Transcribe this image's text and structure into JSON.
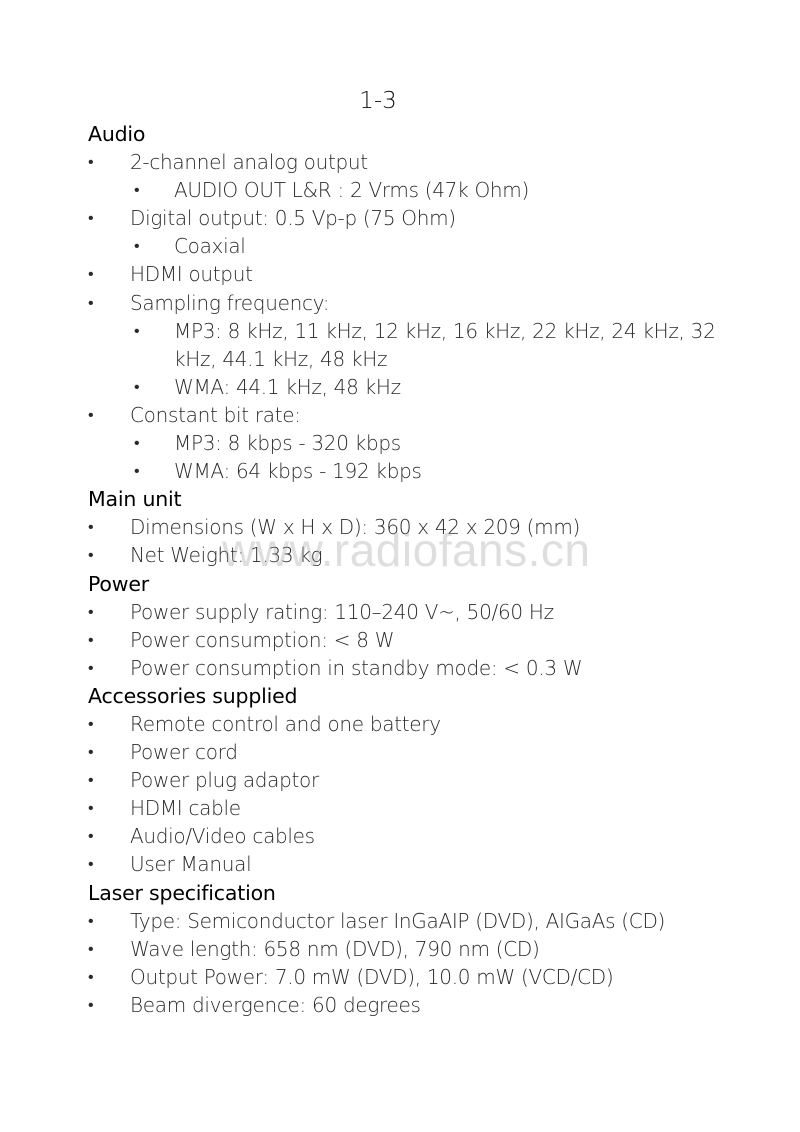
{
  "page_number": "1-3",
  "bullet_glyph": "•",
  "watermark": "www.radiofans.cn",
  "sections": {
    "audio": {
      "title": "Audio",
      "items": [
        {
          "text": "2-channel analog output"
        },
        {
          "text": "AUDIO OUT L&R : 2 Vrms (47k Ohm)",
          "level": 2
        },
        {
          "text": "Digital output: 0.5 Vp-p (75 Ohm)"
        },
        {
          "text": "Coaxial",
          "level": 2
        },
        {
          "text": "HDMI output"
        },
        {
          "text": "Sampling frequency:"
        },
        {
          "text": "MP3: 8 kHz, 11 kHz, 12 kHz, 16 kHz, 22 kHz, 24 kHz, 32",
          "level": 2
        },
        {
          "text": "kHz, 44.1 kHz, 48 kHz",
          "level": 2,
          "continuation": true
        },
        {
          "text": "WMA: 44.1 kHz, 48 kHz",
          "level": 2
        },
        {
          "text": "Constant bit rate:"
        },
        {
          "text": "MP3: 8 kbps - 320 kbps",
          "level": 2
        },
        {
          "text": "WMA: 64 kbps - 192 kbps",
          "level": 2
        }
      ]
    },
    "main_unit": {
      "title": "Main unit",
      "items": [
        {
          "text": "Dimensions (W x H x D): 360 x 42 x 209 (mm)"
        },
        {
          "text": "Net Weight: 1.33 kg"
        }
      ]
    },
    "power": {
      "title": "Power",
      "items": [
        {
          "text": "Power supply rating: 110–240 V~, 50/60 Hz"
        },
        {
          "text": "Power consumption: < 8 W"
        },
        {
          "text": "Power consumption in standby mode: < 0.3 W"
        }
      ]
    },
    "accessories": {
      "title": "Accessories supplied",
      "items": [
        {
          "text": "Remote control and one battery"
        },
        {
          "text": "Power cord"
        },
        {
          "text": "Power plug adaptor"
        },
        {
          "text": "HDMI cable"
        },
        {
          "text": "Audio/Video cables"
        },
        {
          "text": "User Manual"
        }
      ]
    },
    "laser": {
      "title": "Laser specification",
      "items": [
        {
          "text": "Type: Semiconductor laser InGaAIP (DVD), AIGaAs (CD)"
        },
        {
          "text": "Wave length: 658 nm (DVD), 790 nm (CD)"
        },
        {
          "text": "Output Power: 7.0 mW (DVD), 10.0 mW (VCD/CD)"
        },
        {
          "text": "Beam divergence: 60 degrees"
        }
      ]
    }
  }
}
